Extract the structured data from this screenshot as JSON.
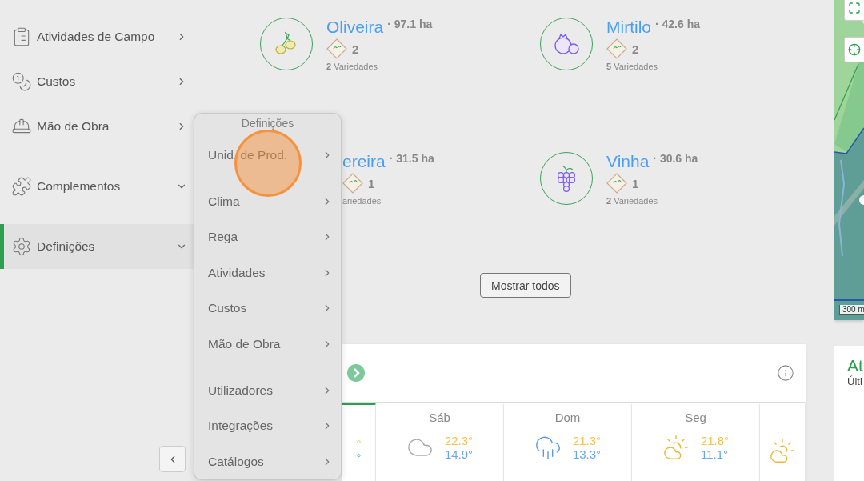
{
  "sidebar": {
    "groups": [
      [
        {
          "label": "Atividades de Campo",
          "expanded": false,
          "selected": false
        },
        {
          "label": "Custos",
          "expanded": false,
          "selected": false
        },
        {
          "label": "Mão de Obra",
          "expanded": false,
          "selected": false
        }
      ],
      [
        {
          "label": "Complementos",
          "expanded": true,
          "selected": false
        }
      ],
      [
        {
          "label": "Definições",
          "expanded": true,
          "selected": true
        }
      ]
    ]
  },
  "crops": [
    {
      "kind": "full",
      "name": "Oliveira",
      "area": "· 97.1 ha",
      "count": "2",
      "varieties": "**2** Variedades"
    },
    {
      "kind": "full",
      "name": "Mirtilo",
      "area": "· 42.6 ha",
      "count": "2",
      "varieties": "**5** Variedades"
    },
    {
      "kind": "cut",
      "name": "ereira",
      "area": "· 31.5 ha",
      "count": "1",
      "varieties": "ariedades"
    },
    {
      "kind": "full",
      "name": "Vinha",
      "area": "· 30.6 ha",
      "count": "1",
      "varieties": "**2** Variedades"
    }
  ],
  "show_all_button": "Mostrar todos",
  "weather": {
    "days": [
      {
        "kind": "cut",
        "selected": true,
        "high": "°",
        "low": "°"
      },
      {
        "kind": "full",
        "selected": false,
        "label": "Sáb",
        "high": "22.3°",
        "low": "14.9°"
      },
      {
        "kind": "full",
        "selected": false,
        "label": "Dom",
        "high": "21.3°",
        "low": "13.3°"
      },
      {
        "kind": "full",
        "selected": false,
        "label": "Seg",
        "high": "21.8°",
        "low": "11.1°"
      },
      {
        "kind": "cut",
        "selected": false
      }
    ]
  },
  "activities_card": {
    "title": "At",
    "subtitle": "Últi"
  },
  "map": {
    "scale": "300 m"
  },
  "settings_menu": {
    "title": "Definições",
    "groups": [
      [
        "Unid. de Prod."
      ],
      [
        "Clima",
        "Rega",
        "Atividades",
        "Custos",
        "Mão de Obra"
      ],
      [
        "Utilizadores",
        "Integrações",
        "Catálogos"
      ]
    ]
  }
}
